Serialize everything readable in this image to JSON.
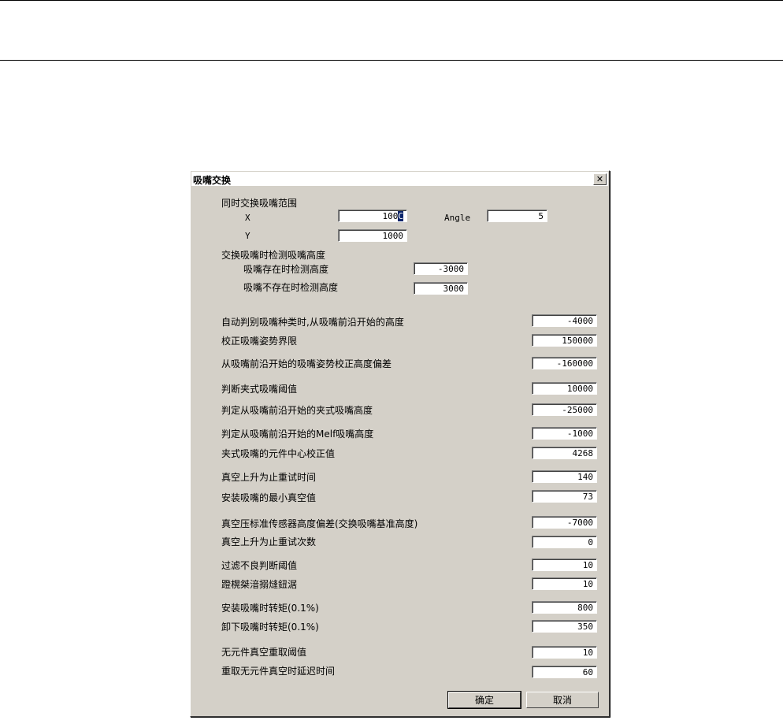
{
  "dialog": {
    "title": "吸嘴交换",
    "close_glyph": "✕",
    "group1_label": "同时交换吸嘴范围",
    "x_label": "X",
    "x_value_prefix": "100",
    "x_value_selected": "C",
    "y_label": "Y",
    "y_value": "1000",
    "angle_label": "Angle",
    "angle_value": "5",
    "group2_label": "交换吸嘴时检测吸嘴高度",
    "exist_label": "吸嘴存在时检测高度",
    "exist_value": "-3000",
    "not_exist_label": "吸嘴不存在时检测高度",
    "not_exist_value": "3000",
    "rows": [
      {
        "label": "自动判别吸嘴种类时,从吸嘴前沿开始的高度",
        "value": "-4000"
      },
      {
        "label": "校正吸嘴姿势界限",
        "value": "150000"
      },
      {
        "label": "从吸嘴前沿开始的吸嘴姿势校正高度偏差",
        "value": "-160000"
      },
      {
        "label": "判断夹式吸嘴阈值",
        "value": "10000"
      },
      {
        "label": "判定从吸嘴前沿开始的夹式吸嘴高度",
        "value": "-25000"
      },
      {
        "label": "判定从吸嘴前沿开始的Melf吸嘴高度",
        "value": "-1000"
      },
      {
        "label": "夹式吸嘴的元件中心校正值",
        "value": "4268"
      },
      {
        "label": "真空上升为止重试时间",
        "value": "140"
      },
      {
        "label": "安装吸嘴的最小真空值",
        "value": "73"
      },
      {
        "label": "真空压标准传感器高度偏差(交换吸嘴基准高度)",
        "value": "-7000"
      },
      {
        "label": "真空上升为止重试次数",
        "value": "0"
      },
      {
        "label": "过滤不良判断阈值",
        "value": "10"
      },
      {
        "label": "蹬榥桀湆搦熢鈕涺",
        "value": "10"
      },
      {
        "label": "安装吸嘴时转矩(0.1%)",
        "value": "800"
      },
      {
        "label": "卸下吸嘴时转矩(0.1%)",
        "value": "350"
      },
      {
        "label": "无元件真空重取阈值",
        "value": "10"
      },
      {
        "label": "重取无元件真空时延迟时间",
        "value": "60"
      }
    ],
    "ok_label": "确定",
    "cancel_label": "取消"
  }
}
